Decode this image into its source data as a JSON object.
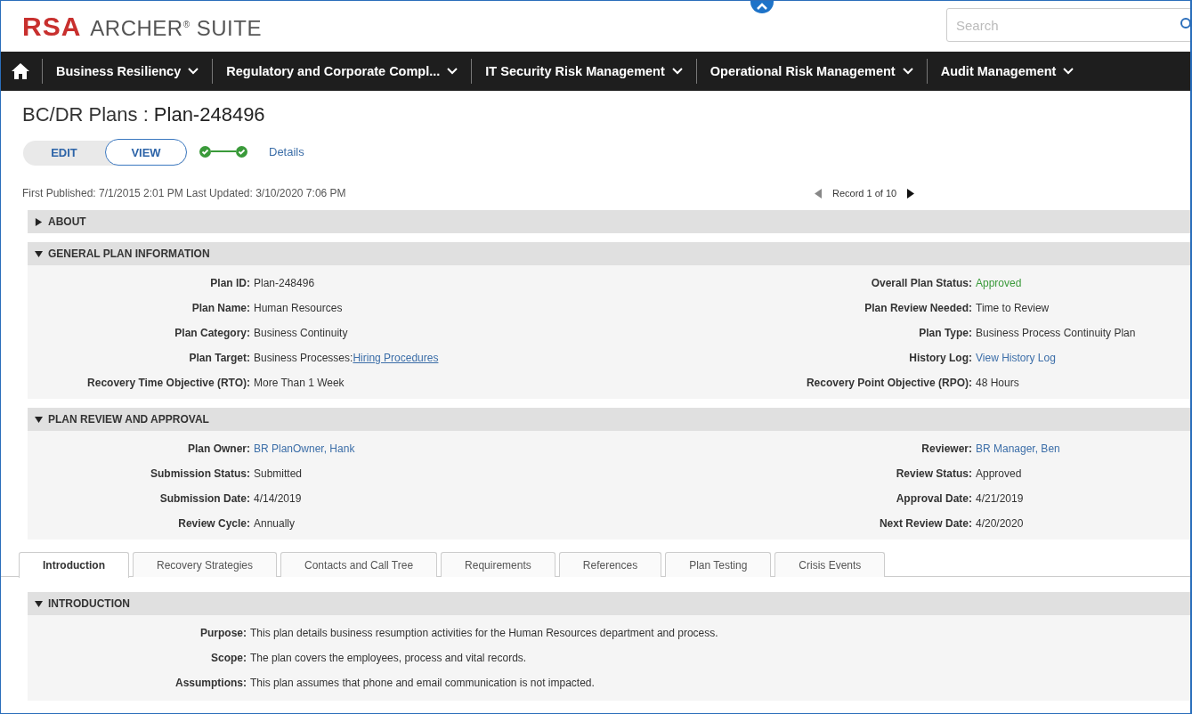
{
  "header": {
    "logo_mark": "RSA",
    "logo_name": "ARCHER$^{®}$ SUITE",
    "search": {
      "placeholder": "Search"
    }
  },
  "nav": {
    "items": [
      {
        "label": "Business Resiliency"
      },
      {
        "label": "Regulatory and Corporate Compl..."
      },
      {
        "label": "IT Security Risk Management"
      },
      {
        "label": "Operational Risk Management"
      },
      {
        "label": "Audit Management"
      }
    ]
  },
  "record": {
    "module": "BC/DR Plans :",
    "name": "Plan-248496"
  },
  "modes": [
    {
      "label": "EDIT",
      "selected": false
    },
    {
      "label": "VIEW",
      "selected": true
    }
  ],
  "workflow": {
    "steps": [
      {
        "done": true
      },
      {
        "done": true
      }
    ],
    "link": "Details"
  },
  "meta": "First Published: 7/1/2015 2:01 PM Last Updated: 3/10/2020 7:06 PM",
  "record_nav": {
    "label": "Record 1 of 10",
    "prev_disabled": true,
    "next_disabled": false
  },
  "sections": [
    {
      "title": "ABOUT",
      "expanded": false
    },
    {
      "title": "GENERAL PLAN INFORMATION",
      "expanded": true,
      "fields": [
        {
          "label": "Plan ID:",
          "value": "Plan-248496",
          "kind": "text"
        },
        {
          "label": "Overall Plan Status:",
          "value": "Approved",
          "kind": "status"
        },
        {
          "label": "Plan Name:",
          "value": "Human Resources",
          "kind": "text"
        },
        {
          "label": "Plan Review Needed:",
          "value": "Time to Review",
          "kind": "text"
        },
        {
          "label": "Plan Category:",
          "value": "Business Continuity",
          "kind": "text"
        },
        {
          "label": "Plan Type:",
          "value": "Business Process Continuity Plan",
          "kind": "text"
        },
        {
          "label": "Plan Target:",
          "value": "Business Processes:",
          "link": "Hiring Procedures",
          "kind": "text_link"
        },
        {
          "label": "History Log:",
          "value": "View History Log",
          "kind": "link"
        },
        {
          "label": "Recovery Time Objective (RTO):",
          "value": "More Than 1 Week",
          "kind": "text"
        },
        {
          "label": "Recovery Point Objective (RPO):",
          "value": "48 Hours",
          "kind": "text"
        }
      ]
    },
    {
      "title": "PLAN REVIEW AND APPROVAL",
      "expanded": true,
      "fields": [
        {
          "label": "Plan Owner:",
          "value": "BR PlanOwner, Hank",
          "kind": "link"
        },
        {
          "label": "Reviewer:",
          "value": "BR Manager, Ben",
          "kind": "link"
        },
        {
          "label": "Submission Status:",
          "value": "Submitted",
          "kind": "text"
        },
        {
          "label": "Review Status:",
          "value": "Approved",
          "kind": "text"
        },
        {
          "label": "Submission Date:",
          "value": "4/14/2019",
          "kind": "text"
        },
        {
          "label": "Approval Date:",
          "value": "4/21/2019",
          "kind": "text"
        },
        {
          "label": "Review Cycle:",
          "value": "Annually",
          "kind": "text"
        },
        {
          "label": "Next Review Date:",
          "value": "4/20/2020",
          "kind": "text"
        }
      ]
    }
  ],
  "tabs": [
    {
      "label": "Introduction",
      "selected": true
    },
    {
      "label": "Recovery Strategies",
      "selected": false
    },
    {
      "label": "Contacts and Call Tree",
      "selected": false
    },
    {
      "label": "Requirements",
      "selected": false
    },
    {
      "label": "References",
      "selected": false
    },
    {
      "label": "Plan Testing",
      "selected": false
    },
    {
      "label": "Crisis Events",
      "selected": false
    }
  ],
  "tab_section": {
    "title": "INTRODUCTION",
    "expanded": true,
    "fields": [
      {
        "label": "Purpose:",
        "value": "This plan details business resumption activities for the Human Resources department and process.",
        "kind": "text"
      },
      {
        "label": "Scope:",
        "value": "The plan covers the employees, process and vital records.",
        "kind": "text"
      },
      {
        "label": "Assumptions:",
        "value": "This plan assumes that phone and email communication is not impacted.",
        "kind": "text"
      }
    ]
  }
}
